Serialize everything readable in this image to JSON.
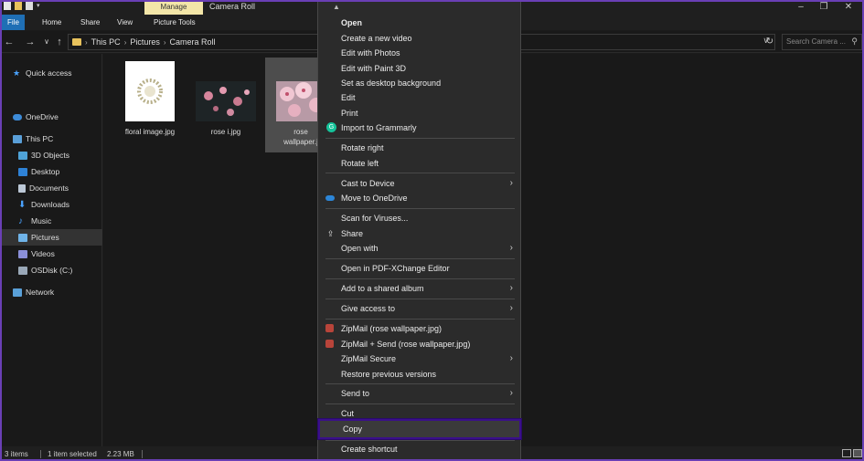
{
  "window": {
    "title": "Camera Roll",
    "manage_tab": "Manage",
    "ribbon_tabs": [
      "File",
      "Home",
      "Share",
      "View",
      "Picture Tools"
    ],
    "controls": [
      "minimize-icon",
      "restore-icon",
      "close-icon"
    ]
  },
  "address": {
    "crumbs": [
      "This PC",
      "Pictures",
      "Camera Roll"
    ],
    "search_placeholder": "Search Camera ..."
  },
  "nav": {
    "items": [
      {
        "label": "Quick access",
        "icon": "star-icon"
      },
      {
        "label": "OneDrive",
        "icon": "cloud-icon"
      },
      {
        "label": "This PC",
        "icon": "computer-icon"
      },
      {
        "label": "3D Objects",
        "icon": "cube-icon"
      },
      {
        "label": "Desktop",
        "icon": "desktop-icon"
      },
      {
        "label": "Documents",
        "icon": "document-icon"
      },
      {
        "label": "Downloads",
        "icon": "download-icon"
      },
      {
        "label": "Music",
        "icon": "music-icon"
      },
      {
        "label": "Pictures",
        "icon": "pictures-icon"
      },
      {
        "label": "Videos",
        "icon": "videos-icon"
      },
      {
        "label": "OSDisk (C:)",
        "icon": "disk-icon"
      },
      {
        "label": "Network",
        "icon": "network-icon"
      }
    ],
    "selected": "Pictures"
  },
  "files": [
    {
      "name": "floral image.jpg"
    },
    {
      "name": "rose i.jpg"
    },
    {
      "name_line1": "rose",
      "name_line2": "wallpaper.j"
    }
  ],
  "status": {
    "count": "3 items",
    "selection": "1 item selected",
    "size": "2.23 MB"
  },
  "context_menu": {
    "items": [
      {
        "label": "Open",
        "bold": true
      },
      {
        "label": "Create a new video"
      },
      {
        "label": "Edit with Photos"
      },
      {
        "label": "Edit with Paint 3D"
      },
      {
        "label": "Set as desktop background"
      },
      {
        "label": "Edit"
      },
      {
        "label": "Print"
      },
      {
        "label": "Import to Grammarly",
        "icon": "grammarly-icon"
      },
      {
        "label": "Rotate right"
      },
      {
        "label": "Rotate left"
      },
      {
        "label": "Cast to Device",
        "submenu": true
      },
      {
        "label": "Move to OneDrive",
        "icon": "onedrive-icon"
      },
      {
        "label": "Scan for Viruses..."
      },
      {
        "label": "Share",
        "icon": "share-icon"
      },
      {
        "label": "Open with",
        "submenu": true
      },
      {
        "label": "Open in PDF-XChange Editor"
      },
      {
        "label": "Add to a shared album",
        "submenu": true
      },
      {
        "label": "Give access to",
        "submenu": true
      },
      {
        "label": "ZipMail (rose wallpaper.jpg)",
        "icon": "zipmail-icon"
      },
      {
        "label": "ZipMail + Send (rose wallpaper.jpg)",
        "icon": "zipmail-icon"
      },
      {
        "label": "ZipMail Secure",
        "submenu": true
      },
      {
        "label": "Restore previous versions"
      },
      {
        "label": "Send to",
        "submenu": true
      },
      {
        "label": "Cut"
      },
      {
        "label": "Copy",
        "highlighted": true
      },
      {
        "label": "Create shortcut"
      }
    ]
  },
  "colors": {
    "background": "#191919",
    "file_tab": "#1f6fb5",
    "manage_tab": "#f3e6a8",
    "highlight_border": "#3a0f8a",
    "selection": "#4d4d4d"
  }
}
